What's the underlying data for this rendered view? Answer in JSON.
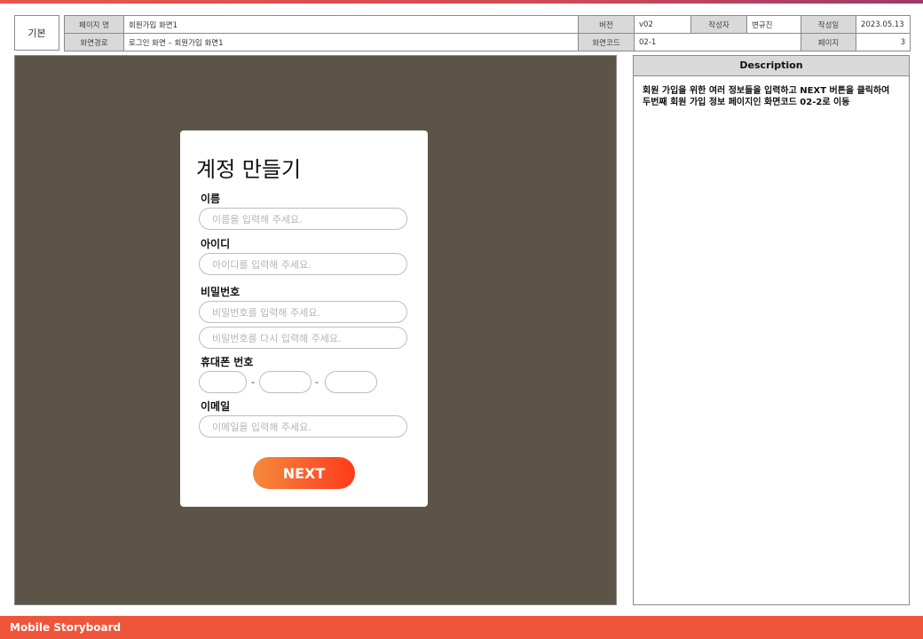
{
  "header": {
    "kind": "기본",
    "page_name_label": "페이지 명",
    "page_name": "회원가입 화면1",
    "version_label": "버전",
    "version": "v02",
    "author_label": "작성자",
    "author": "변규진",
    "date_label": "작성일",
    "date": "2023.05.13",
    "path_label": "화면경로",
    "path": "로그인 화면 – 회원가입 화면1",
    "screen_code_label": "화면코드",
    "screen_code": "02-1",
    "page_label": "페이지",
    "page": "3"
  },
  "form": {
    "title": "계정 만들기",
    "name_label": "이름",
    "name_placeholder": "이름을 입력해 주세요.",
    "id_label": "아이디",
    "id_placeholder": "아이디를 입력해 주세요.",
    "password_label": "비밀번호",
    "password_placeholder": "비밀번호를 입력해 주세요.",
    "password_confirm_placeholder": "비밀번호를 다시 입력해 주세요.",
    "phone_label": "휴대폰 번호",
    "phone_separator": "-",
    "email_label": "이메일",
    "email_placeholder": "이메일을 입력해 주세요.",
    "next_label": "NEXT"
  },
  "description": {
    "title": "Description",
    "text": "회원 가입을 위한 여러 정보들을 입력하고 NEXT 버튼을 클릭하여 두번째 회원 가입 정보 페이지인 화면코드 02-2로 이동"
  },
  "footer": {
    "label": "Mobile Storyboard"
  },
  "colors": {
    "canvas": "#5c5447",
    "footer": "#ef553a",
    "button_start": "#f58a3c",
    "button_end": "#ff3a1a",
    "header_label_bg": "#d9d9d9"
  }
}
